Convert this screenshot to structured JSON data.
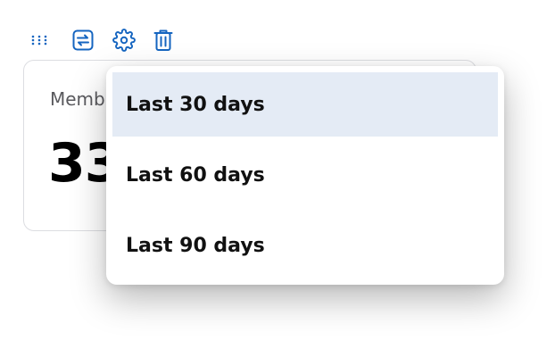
{
  "colors": {
    "icon_accent": "#1565c0",
    "selected_bg": "#e4ebf5",
    "card_border": "#dcdde1"
  },
  "toolbar": {
    "icons": [
      "drag-handle-icon",
      "swap-icon",
      "settings-gear-icon",
      "trash-icon"
    ]
  },
  "card": {
    "label": "Memb",
    "value": "33"
  },
  "menu": {
    "selected": "Last 30 days",
    "items": [
      {
        "label": "Last 30 days"
      },
      {
        "label": "Last 60 days"
      },
      {
        "label": "Last 90 days"
      }
    ]
  }
}
